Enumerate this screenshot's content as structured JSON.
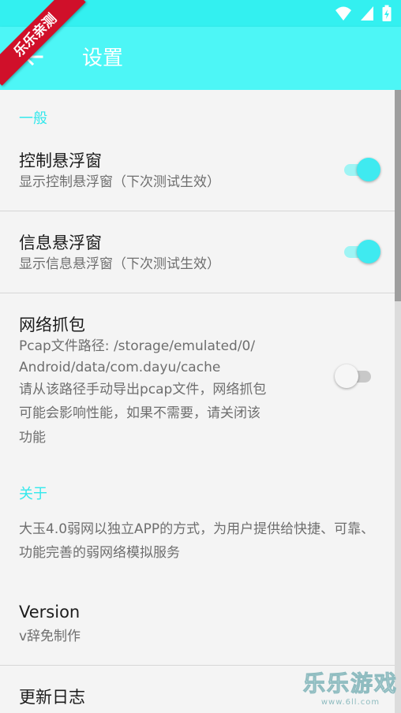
{
  "app": {
    "title": "设置"
  },
  "sections": {
    "general": "一般",
    "about": "关于"
  },
  "prefs": {
    "control_float": {
      "title": "控制悬浮窗",
      "summary": "显示控制悬浮窗（下次测试生效）",
      "enabled": true
    },
    "info_float": {
      "title": "信息悬浮窗",
      "summary": "显示信息悬浮窗（下次测试生效）",
      "enabled": true
    },
    "capture": {
      "title": "网络抓包",
      "summary_line1": "Pcap文件路径: /storage/emulated/0/",
      "summary_line2": "Android/data/com.dayu/cache",
      "summary_line3": "请从该路径手动导出pcap文件，网络抓包",
      "summary_line4": "可能会影响性能，如果不需要，请关闭该",
      "summary_line5": "功能",
      "enabled": false
    },
    "about_text": "大玉4.0弱网以独立APP的方式，为用户提供给快捷、可靠、功能完善的弱网络模拟服务",
    "version": {
      "title": "Version",
      "summary": "v辞免制作"
    },
    "changelog": {
      "title": "更新日志"
    }
  },
  "overlays": {
    "ribbon_text": "乐乐亲测",
    "watermark_logo": "乐乐游戏",
    "watermark_url": "www.6ll.com"
  },
  "colors": {
    "accent": "#4df6f6",
    "section": "#33e8ec"
  },
  "icons": {
    "back": "arrow-left-icon",
    "wifi": "wifi-icon",
    "battery": "battery-icon"
  }
}
